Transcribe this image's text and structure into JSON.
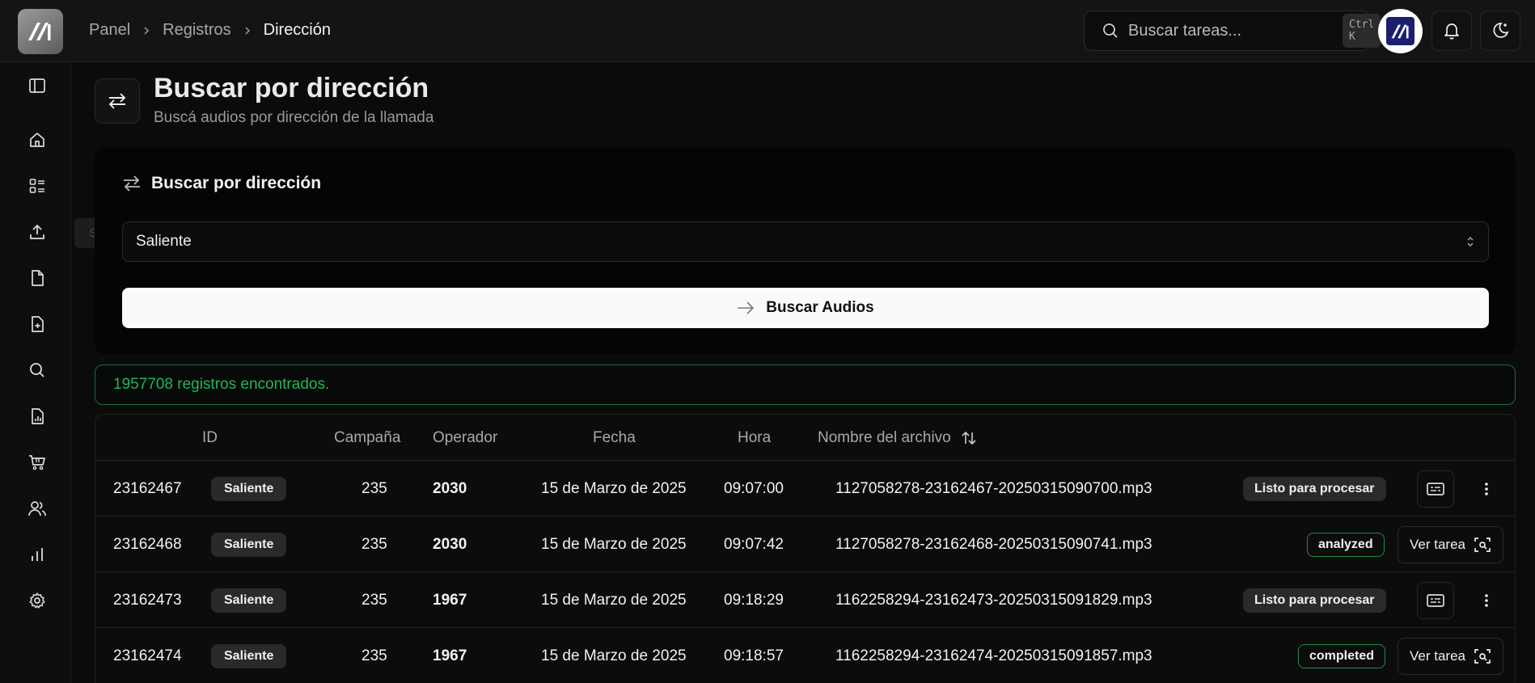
{
  "breadcrumb": {
    "items": [
      "Panel",
      "Registros",
      "Dirección"
    ]
  },
  "search": {
    "placeholder": "Buscar tareas...",
    "shortcut": "Ctrl K"
  },
  "sidebar": {
    "tooltip": "Subir archivo"
  },
  "header": {
    "title": "Buscar por dirección",
    "subtitle": "Buscá audios por dirección de la llamada"
  },
  "card": {
    "title": "Buscar por dirección",
    "select_value": "Saliente",
    "button_label": "Buscar Audios"
  },
  "alert": {
    "text": "1957708 registros encontrados."
  },
  "table": {
    "columns": [
      "ID",
      "Campaña",
      "Operador",
      "Fecha",
      "Hora",
      "Nombre del archivo"
    ],
    "view_task_label": "Ver tarea",
    "rows": [
      {
        "id": "23162467",
        "direction": "Saliente",
        "campaign": "235",
        "operator": "2030",
        "date": "15 de Marzo de 2025",
        "time": "09:07:00",
        "file": "1127058278-23162467-20250315090700.mp3",
        "status": "Listo para procesar"
      },
      {
        "id": "23162468",
        "direction": "Saliente",
        "campaign": "235",
        "operator": "2030",
        "date": "15 de Marzo de 2025",
        "time": "09:07:42",
        "file": "1127058278-23162468-20250315090741.mp3",
        "status": "analyzed"
      },
      {
        "id": "23162473",
        "direction": "Saliente",
        "campaign": "235",
        "operator": "1967",
        "date": "15 de Marzo de 2025",
        "time": "09:18:29",
        "file": "1162258294-23162473-20250315091829.mp3",
        "status": "Listo para procesar"
      },
      {
        "id": "23162474",
        "direction": "Saliente",
        "campaign": "235",
        "operator": "1967",
        "date": "15 de Marzo de 2025",
        "time": "09:18:57",
        "file": "1162258294-23162474-20250315091857.mp3",
        "status": "completed"
      }
    ]
  }
}
